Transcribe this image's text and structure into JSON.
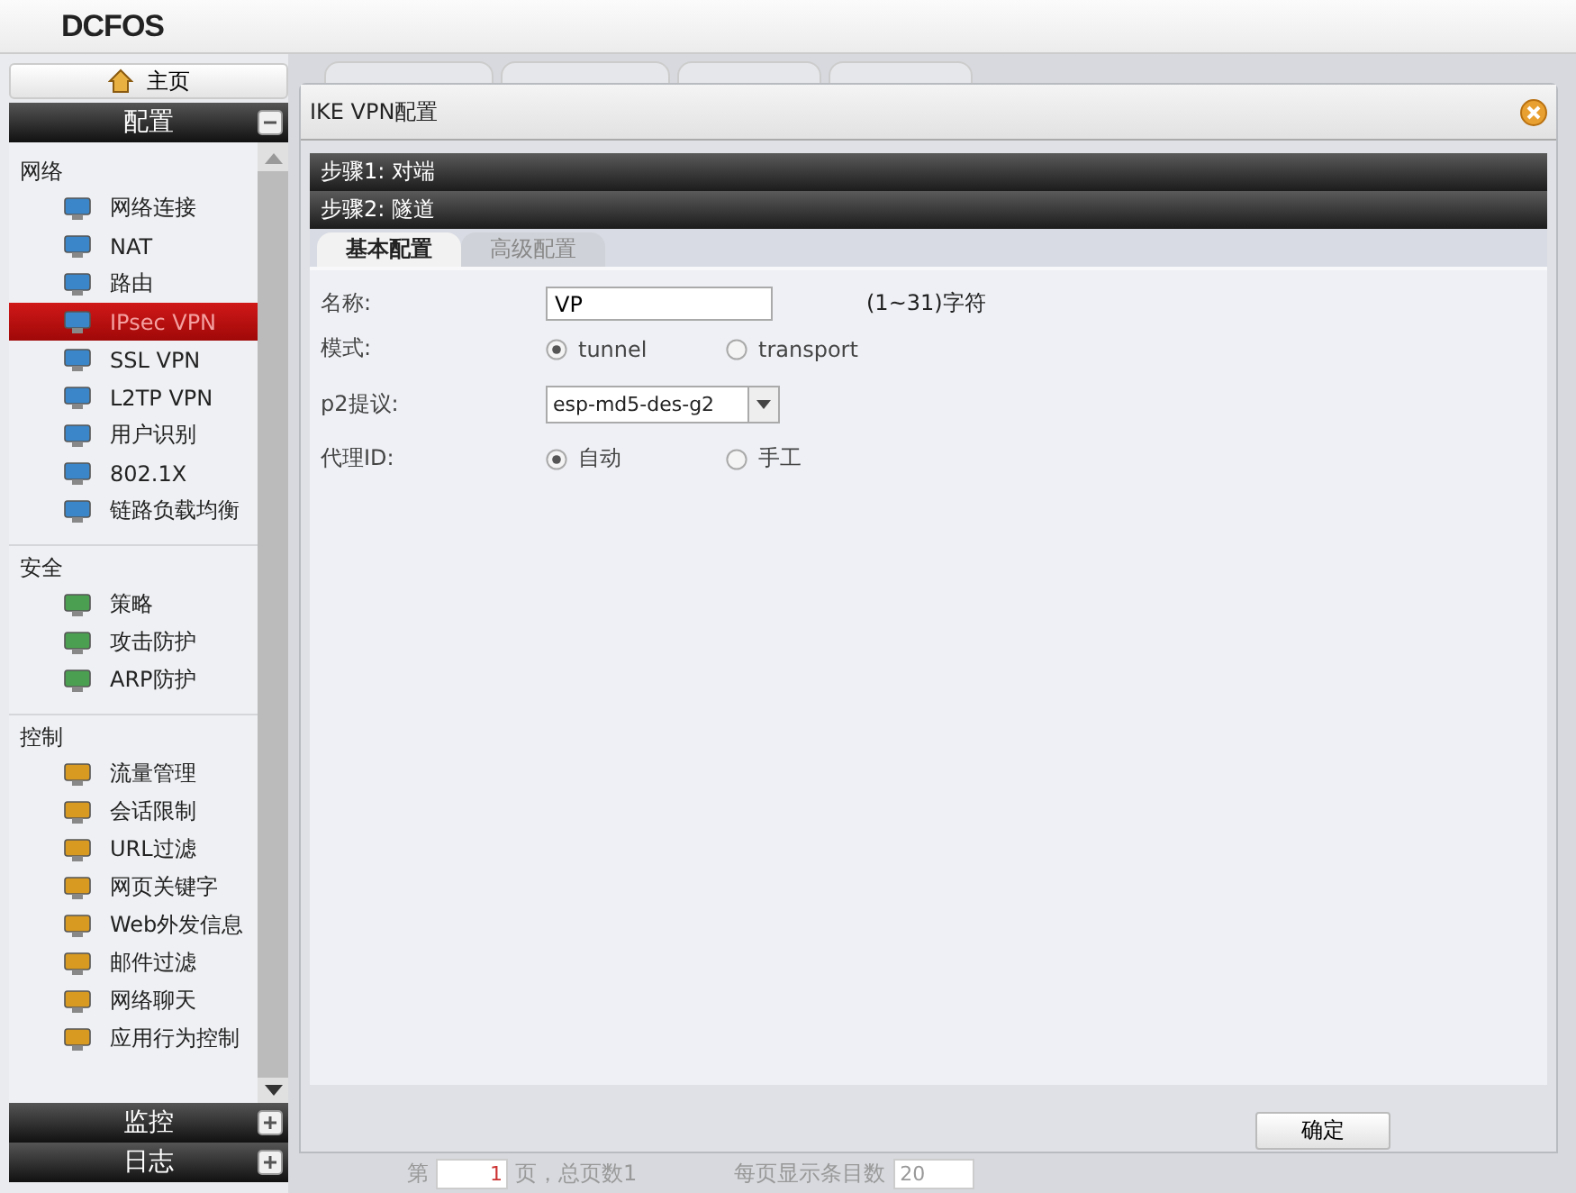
{
  "header": {
    "logo": "DCFOS"
  },
  "sidebar": {
    "home": "主页",
    "sections": [
      {
        "label": "配置",
        "expanded": true
      },
      {
        "label": "监控",
        "expanded": false
      },
      {
        "label": "日志",
        "expanded": false
      }
    ],
    "groups": [
      {
        "title": "网络",
        "items": [
          {
            "label": "网络连接",
            "selected": false
          },
          {
            "label": "NAT",
            "selected": false
          },
          {
            "label": "路由",
            "selected": false
          },
          {
            "label": "IPsec VPN",
            "selected": true
          },
          {
            "label": "SSL VPN",
            "selected": false
          },
          {
            "label": "L2TP VPN",
            "selected": false
          },
          {
            "label": "用户识别",
            "selected": false
          },
          {
            "label": "802.1X",
            "selected": false
          },
          {
            "label": "链路负载均衡",
            "selected": false
          }
        ]
      },
      {
        "title": "安全",
        "items": [
          {
            "label": "策略",
            "selected": false
          },
          {
            "label": "攻击防护",
            "selected": false
          },
          {
            "label": "ARP防护",
            "selected": false
          }
        ]
      },
      {
        "title": "控制",
        "items": [
          {
            "label": "流量管理",
            "selected": false
          },
          {
            "label": "会话限制",
            "selected": false
          },
          {
            "label": "URL过滤",
            "selected": false
          },
          {
            "label": "网页关键字",
            "selected": false
          },
          {
            "label": "Web外发信息",
            "selected": false
          },
          {
            "label": "邮件过滤",
            "selected": false
          },
          {
            "label": "网络聊天",
            "selected": false
          },
          {
            "label": "应用行为控制",
            "selected": false
          }
        ]
      }
    ]
  },
  "dialog": {
    "title": "IKE VPN配置",
    "steps": [
      "步骤1: 对端",
      "步骤2: 隧道"
    ],
    "tabs": [
      {
        "label": "基本配置",
        "selected": true
      },
      {
        "label": "高级配置",
        "selected": false
      }
    ],
    "fields": [
      {
        "kind": "text",
        "label": "名称:",
        "value": "VP",
        "hint": "(1~31)字符"
      },
      {
        "kind": "radio",
        "label": "模式:",
        "options": [
          {
            "label": "tunnel",
            "selected": true
          },
          {
            "label": "transport",
            "selected": false
          }
        ]
      },
      {
        "kind": "select",
        "label": "p2提议:",
        "value": "esp-md5-des-g2"
      },
      {
        "kind": "radio",
        "label": "代理ID:",
        "options": [
          {
            "label": "自动",
            "selected": true
          },
          {
            "label": "手工",
            "selected": false
          }
        ]
      }
    ],
    "buttons": [
      "确定"
    ]
  },
  "pager": {
    "page_prefix": "第",
    "page": "1",
    "page_suffix": "页，总页数1",
    "per_page_label": "每页显示条目数",
    "per_page": "20"
  }
}
